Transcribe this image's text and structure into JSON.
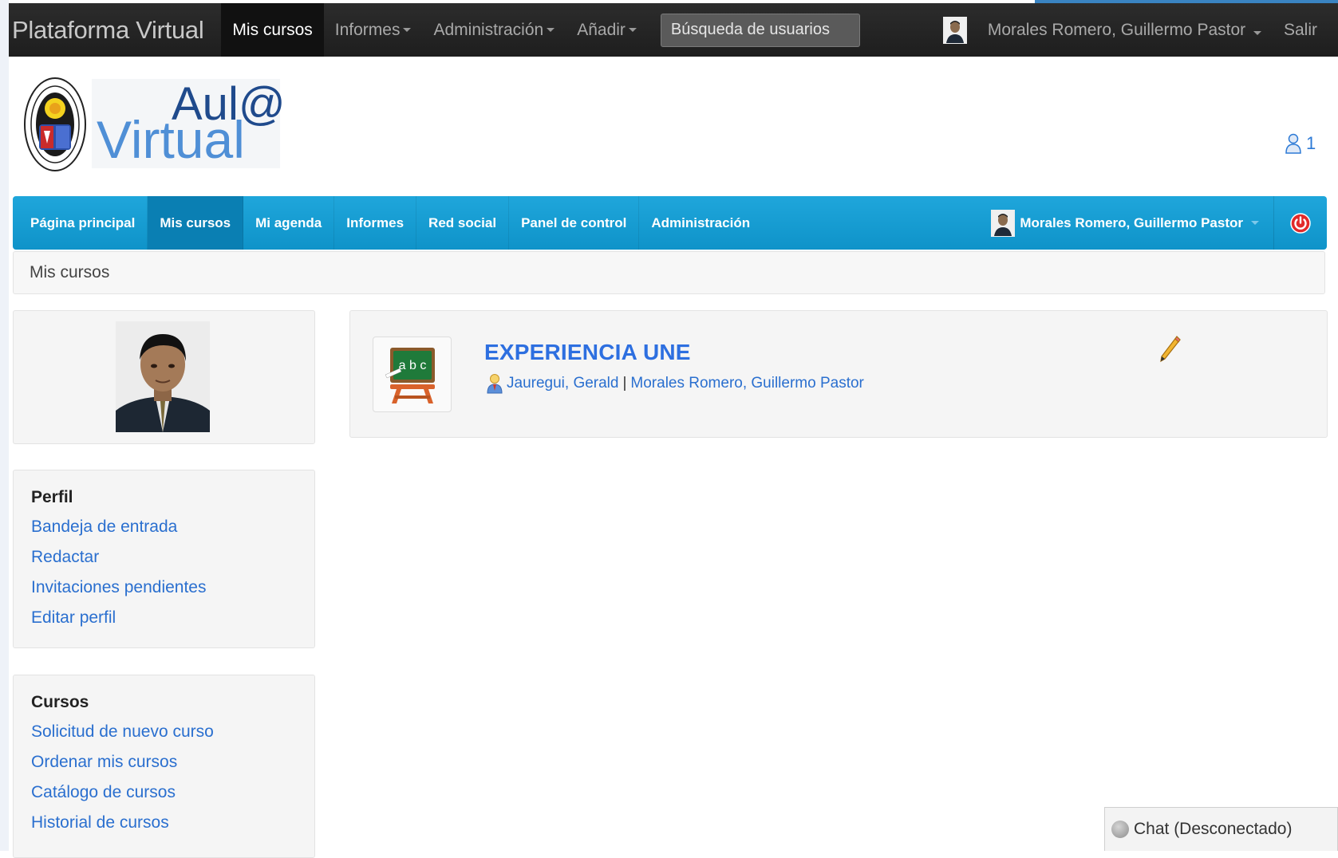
{
  "topbar": {
    "brand": "Plataforma Virtual",
    "items": [
      {
        "label": "Mis cursos",
        "active": true,
        "dropdown": false
      },
      {
        "label": "Informes",
        "active": false,
        "dropdown": true
      },
      {
        "label": "Administración",
        "active": false,
        "dropdown": true
      },
      {
        "label": "Añadir",
        "active": false,
        "dropdown": true
      }
    ],
    "search_placeholder": "Búsqueda de usuarios",
    "user_name": "Morales Romero, Guillermo Pastor",
    "exit_label": "Salir"
  },
  "header": {
    "logo_text_top": "Aul@",
    "logo_text_bottom": "Virtual",
    "notification_count": "1"
  },
  "bluenav": {
    "items": [
      {
        "label": "Página principal",
        "active": false
      },
      {
        "label": "Mis cursos",
        "active": true
      },
      {
        "label": "Mi agenda",
        "active": false
      },
      {
        "label": "Informes",
        "active": false
      },
      {
        "label": "Red social",
        "active": false
      },
      {
        "label": "Panel de control",
        "active": false
      },
      {
        "label": "Administración",
        "active": false
      }
    ],
    "user_name": "Morales Romero, Guillermo Pastor"
  },
  "breadcrumb": "Mis cursos",
  "profile_menu": {
    "title": "Perfil",
    "links": [
      "Bandeja de entrada",
      "Redactar",
      "Invitaciones pendientes",
      "Editar perfil"
    ]
  },
  "courses_menu": {
    "title": "Cursos",
    "links": [
      "Solicitud de nuevo curso",
      "Ordenar mis cursos",
      "Catálogo de cursos",
      "Historial de cursos"
    ]
  },
  "course": {
    "title": "EXPERIENCIA UNE",
    "thumb_text": "a b c",
    "teachers": [
      "Jauregui, Gerald",
      "Morales Romero, Guillermo Pastor"
    ],
    "separator": "|"
  },
  "chat": {
    "label": "Chat (Desconectado)"
  },
  "colors": {
    "topbar": "#222222",
    "bluenav": "#1aa0d7",
    "link": "#2a6fcf",
    "course_title": "#2d6fe0",
    "power_icon": "#e22a2a"
  }
}
